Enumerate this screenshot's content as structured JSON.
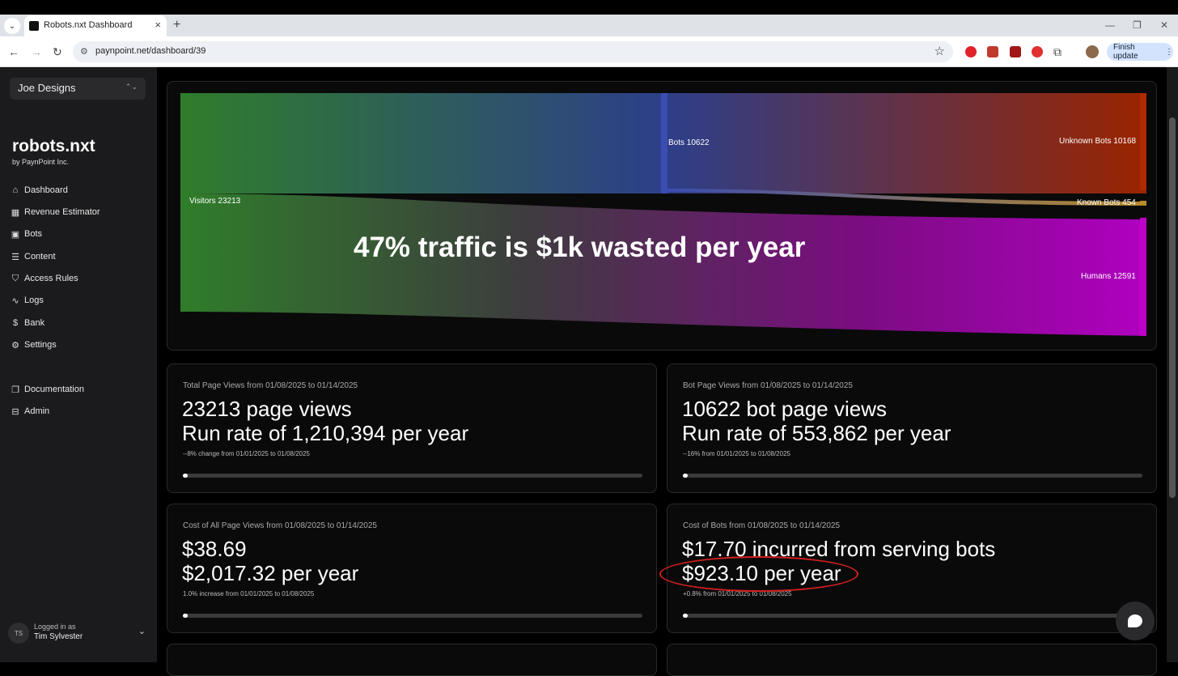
{
  "browser": {
    "tab_title": "Robots.nxt Dashboard",
    "url": "paynpoint.net/dashboard/39",
    "finish_update_label": "Finish update"
  },
  "sidebar": {
    "org_name": "Joe Designs",
    "brand": "robots.nxt",
    "brand_sub": "by PaynPoint Inc.",
    "items": [
      {
        "label": "Dashboard",
        "icon": "home-icon"
      },
      {
        "label": "Revenue Estimator",
        "icon": "calculator-icon"
      },
      {
        "label": "Bots",
        "icon": "bot-icon"
      },
      {
        "label": "Content",
        "icon": "list-icon"
      },
      {
        "label": "Access Rules",
        "icon": "shield-icon"
      },
      {
        "label": "Logs",
        "icon": "activity-icon"
      },
      {
        "label": "Bank",
        "icon": "dollar-icon"
      },
      {
        "label": "Settings",
        "icon": "gear-icon"
      }
    ],
    "secondary": [
      {
        "label": "Documentation",
        "icon": "doc-icon"
      },
      {
        "label": "Admin",
        "icon": "lock-icon"
      }
    ],
    "user": {
      "initials": "TS",
      "logged_in_label": "Logged in as",
      "name": "Tim Sylvester"
    }
  },
  "sankey": {
    "headline": "47% traffic is $1k wasted per year",
    "nodes": {
      "visitors": "Visitors 23213",
      "bots": "Bots 10622",
      "unknown_bots": "Unknown Bots 10168",
      "known_bots": "Known Bots 454",
      "humans": "Humans 12591"
    },
    "colors": {
      "visitors": "#2f7d2a",
      "bots": "#3b4db0",
      "unknown": "#b02a00",
      "known": "#b88a2a",
      "humans": "#c000c8"
    }
  },
  "stats": [
    {
      "caption": "Total Page Views from 01/08/2025 to 01/14/2025",
      "line1": "23213 page views",
      "line2": "Run rate of 1,210,394 per year",
      "note": "--8% change from 01/01/2025 to 01/08/2025",
      "progress": 0
    },
    {
      "caption": "Bot Page Views from 01/08/2025 to 01/14/2025",
      "line1": "10622 bot page views",
      "line2": "Run rate of 553,862 per year",
      "note": "--16% from 01/01/2025 to 01/08/2025",
      "progress": 0
    },
    {
      "caption": "Cost of All Page Views from 01/08/2025 to 01/14/2025",
      "line1": "$38.69",
      "line2": "$2,017.32 per year",
      "note": "1.0% increase from 01/01/2025 to 01/08/2025",
      "progress": 0.01
    },
    {
      "caption": "Cost of Bots from 01/08/2025 to 01/14/2025",
      "line1": "$17.70 incurred from serving bots",
      "line2": "$923.10 per year",
      "note": "+0.8% from 01/01/2025 to 01/08/2025",
      "progress": 0.008
    }
  ]
}
